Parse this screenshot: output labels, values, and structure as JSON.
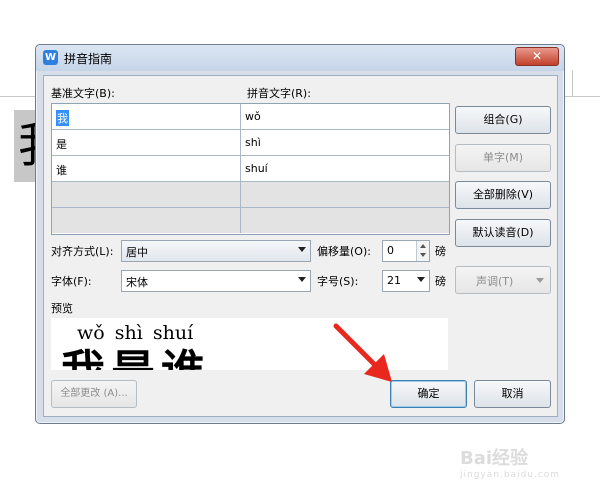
{
  "background_doc": {
    "char": "我"
  },
  "dialog": {
    "title": "拼音指南",
    "icon_letter": "W",
    "close_glyph": "✕"
  },
  "labels": {
    "base_text": "基准文字(B):",
    "pinyin_text": "拼音文字(R):",
    "align": "对齐方式(L):",
    "offset": "偏移量(O):",
    "offset_unit": "磅",
    "font": "字体(F):",
    "font_size": "字号(S):",
    "font_size_unit": "磅",
    "preview": "预览"
  },
  "rows": [
    {
      "base": "我",
      "pinyin": "wǒ"
    },
    {
      "base": "是",
      "pinyin": "shì"
    },
    {
      "base": "谁",
      "pinyin": "shuí"
    },
    {
      "base": "",
      "pinyin": ""
    },
    {
      "base": "",
      "pinyin": ""
    }
  ],
  "buttons": {
    "combine": "组合(G)",
    "single": "单字(M)",
    "delete_all": "全部删除(V)",
    "default_reading": "默认读音(D)",
    "tone": "声调(T)",
    "change_all": "全部更改 (A)...",
    "ok": "确定",
    "cancel": "取消"
  },
  "fields": {
    "align_value": "居中",
    "offset_value": "0",
    "font_value": "宋体",
    "font_size_value": "21"
  },
  "preview": {
    "pinyin": "wǒ shì shuí",
    "chars": "我是谁"
  },
  "watermark": {
    "brand": "Bai经验",
    "sub": "jingyan.baidu.com"
  },
  "colors": {
    "arrow": "#e8281e",
    "selection": "#3390ff",
    "close": "#c2402c"
  }
}
